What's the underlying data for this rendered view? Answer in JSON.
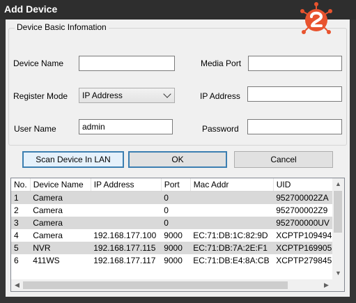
{
  "window": {
    "title": "Add Device"
  },
  "group": {
    "title": "Device Basic Infomation"
  },
  "form": {
    "device_name_label": "Device Name",
    "device_name_value": "",
    "media_port_label": "Media Port",
    "media_port_value": "",
    "register_mode_label": "Register Mode",
    "register_mode_value": "IP Address",
    "ip_address_label": "IP Address",
    "ip_address_value": "",
    "user_name_label": "User Name",
    "user_name_value": "admin",
    "password_label": "Password",
    "password_value": ""
  },
  "buttons": {
    "scan": "Scan Device In LAN",
    "ok": "OK",
    "cancel": "Cancel"
  },
  "table": {
    "columns": [
      "No.",
      "Device Name",
      "IP Address",
      "Port",
      "Mac Addr",
      "UID"
    ],
    "rows": [
      [
        "1",
        "Camera",
        "",
        "0",
        "",
        "952700002ZA"
      ],
      [
        "2",
        "Camera",
        "",
        "0",
        "",
        "952700002Z9"
      ],
      [
        "3",
        "Camera",
        "",
        "0",
        "",
        "952700000UV"
      ],
      [
        "4",
        "Camera",
        "192.168.177.100",
        "9000",
        "EC:71:DB:1C:82:9D",
        "XCPTP109494"
      ],
      [
        "5",
        "NVR",
        "192.168.177.115",
        "9000",
        "EC:71:DB:7A:2E:F1",
        "XCPTP169905"
      ],
      [
        "6",
        "411WS",
        "192.168.177.117",
        "9000",
        "EC:71:DB:E4:8A:CB",
        "XCPTP279845"
      ]
    ]
  },
  "colors": {
    "accent": "#e8532e",
    "title_bg": "#2e2e2e",
    "row_alt": "#d9d9d9"
  }
}
